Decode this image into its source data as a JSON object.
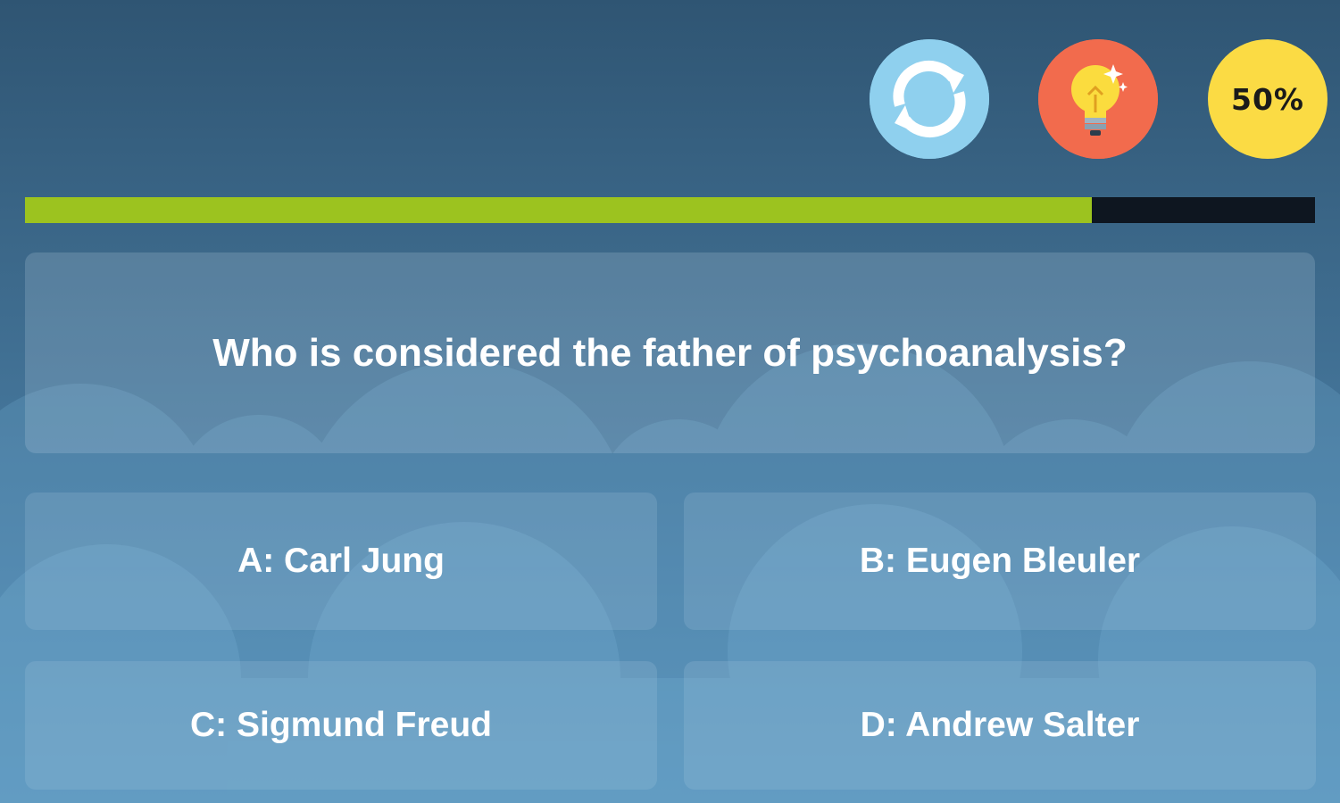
{
  "lifelines": {
    "swap": {
      "icon": "refresh-icon",
      "color": "#8fd0ee"
    },
    "hint": {
      "icon": "lightbulb-icon",
      "color": "#f26b4d"
    },
    "fifty_fifty": {
      "label": "50%",
      "color": "#fbdb44"
    }
  },
  "progress": {
    "fraction": 0.827,
    "fill_color": "#9cc31f",
    "track_color": "#0e1620"
  },
  "question": {
    "text": "Who is considered the father of psychoanalysis?"
  },
  "answers": [
    {
      "text": "A: Carl Jung"
    },
    {
      "text": "B: Eugen Bleuler"
    },
    {
      "text": "C: Sigmund Freud"
    },
    {
      "text": "D: Andrew Salter"
    }
  ]
}
